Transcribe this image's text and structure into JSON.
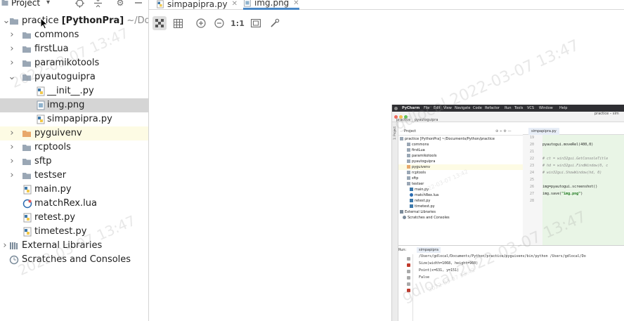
{
  "panel": {
    "title": "Project"
  },
  "tree": {
    "root": {
      "name": "practice",
      "module": "[PythonPra]",
      "path": "~/Docu"
    },
    "items": [
      {
        "label": "commons"
      },
      {
        "label": "firstLua"
      },
      {
        "label": "paramikotools"
      },
      {
        "label": "pyautoguipra"
      },
      {
        "label": "__init__.py"
      },
      {
        "label": "img.png"
      },
      {
        "label": "simpapipra.py"
      },
      {
        "label": "pyguivenv"
      },
      {
        "label": "rcptools"
      },
      {
        "label": "sftp"
      },
      {
        "label": "testser"
      },
      {
        "label": "main.py"
      },
      {
        "label": "matchRex.lua"
      },
      {
        "label": "retest.py"
      },
      {
        "label": "timetest.py"
      },
      {
        "label": "External Libraries"
      },
      {
        "label": "Scratches and Consoles"
      }
    ]
  },
  "tabs": [
    {
      "label": "simpapipra.py"
    },
    {
      "label": "img.png"
    }
  ],
  "toolbar": {
    "zoom_actual_label": "1:1"
  },
  "screenshot": {
    "menubar": [
      "PyCharm",
      "File",
      "Edit",
      "View",
      "Navigate",
      "Code",
      "Refactor",
      "Run",
      "Tools",
      "VCS",
      "Window",
      "Help"
    ],
    "window_title": "practice – sim",
    "breadcrumb": [
      "practice",
      "pyautoguipra"
    ],
    "side_label": "1: Project",
    "project_header": "Project",
    "tree": [
      {
        "label": "practice [PythonPra] ~/Documents/Python/practice"
      },
      {
        "label": "commons"
      },
      {
        "label": "firstLua"
      },
      {
        "label": "paramikotools"
      },
      {
        "label": "pyautoguipra"
      },
      {
        "label": "pyguivenv"
      },
      {
        "label": "rcptools"
      },
      {
        "label": "sftp"
      },
      {
        "label": "testser"
      },
      {
        "label": "main.py"
      },
      {
        "label": "matchRex.lua"
      },
      {
        "label": "retest.py"
      },
      {
        "label": "timetest.py"
      },
      {
        "label": "External Libraries"
      },
      {
        "label": "Scratches and Consoles"
      }
    ],
    "editor_tab": "simpapipra.py",
    "line_numbers": [
      "19",
      "20",
      "21",
      "22",
      "23",
      "24",
      "25",
      "26",
      "27",
      "28"
    ],
    "code": {
      "l20": "pyautogui.moveRel(400,0)",
      "l22": "# ct = win32gui.GetConsoleTitle",
      "l23": "# hd = win32gui.FindWindow(0, c",
      "l24": "# win32gui.ShowWindow(hd, 0)",
      "l26": "img=pyautogui.screenshot()",
      "l27_pre": "img.save(",
      "l27_str": "\"img.png\"",
      "l27_post": ")"
    },
    "run_header": "Run:",
    "run_tab": "simpapipra",
    "output": [
      "/Users/gdlocal/Documents/Python/practice/pyguivenv/bin/python /Users/gdlocal/Do",
      "Size(width=1068, height=960)",
      "Point(x=631, y=151)",
      "False"
    ]
  },
  "watermark": {
    "text": "gdlocal 2022-03-07 13:47",
    "short": "2022-03-07 13:47",
    "stamp": "2022-03-07 13:42"
  },
  "colors": {
    "folder": "#9aa7b5",
    "venv_folder": "#e8a86a",
    "accent": "#4a88c7",
    "selection": "#d5d5d5",
    "venv_row": "#fdfbe4",
    "code_bg": "#e9f5e6"
  }
}
